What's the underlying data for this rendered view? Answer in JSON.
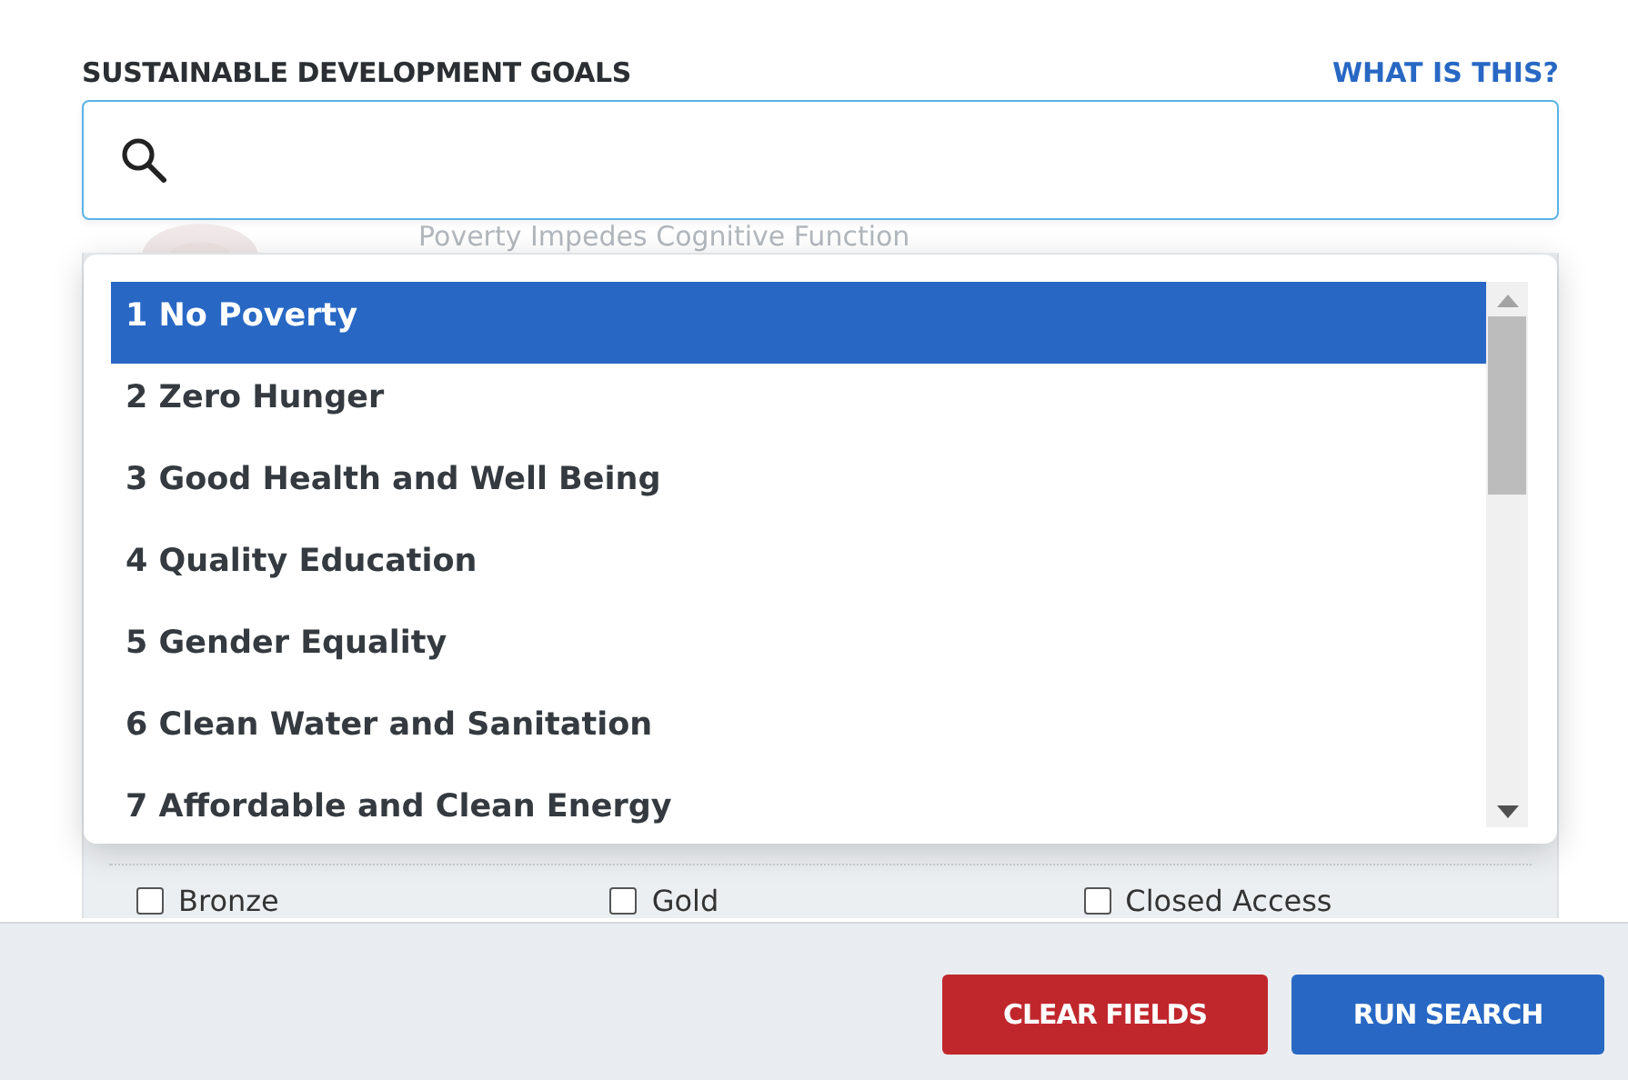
{
  "filter": {
    "label": "SUSTAINABLE DEVELOPMENT GOALS",
    "help_link": "WHAT IS THIS?"
  },
  "background": {
    "ghost_title": "Poverty Impedes Cognitive Function",
    "checkboxes": [
      {
        "label": "Bronze",
        "checked": false
      },
      {
        "label": "Gold",
        "checked": false
      },
      {
        "label": "Closed Access",
        "checked": false
      }
    ]
  },
  "dropdown": {
    "options": [
      {
        "label": "1 No Poverty",
        "selected": true
      },
      {
        "label": "2 Zero Hunger",
        "selected": false
      },
      {
        "label": "3 Good Health and Well Being",
        "selected": false
      },
      {
        "label": "4 Quality Education",
        "selected": false
      },
      {
        "label": "5 Gender Equality",
        "selected": false
      },
      {
        "label": "6 Clean Water and Sanitation",
        "selected": false
      },
      {
        "label": "7 Affordable and Clean Energy",
        "selected": false
      }
    ]
  },
  "buttons": [
    {
      "label": "CLEAR FIELDS",
      "kind": "danger"
    },
    {
      "label": "RUN SEARCH",
      "kind": "primary"
    }
  ]
}
